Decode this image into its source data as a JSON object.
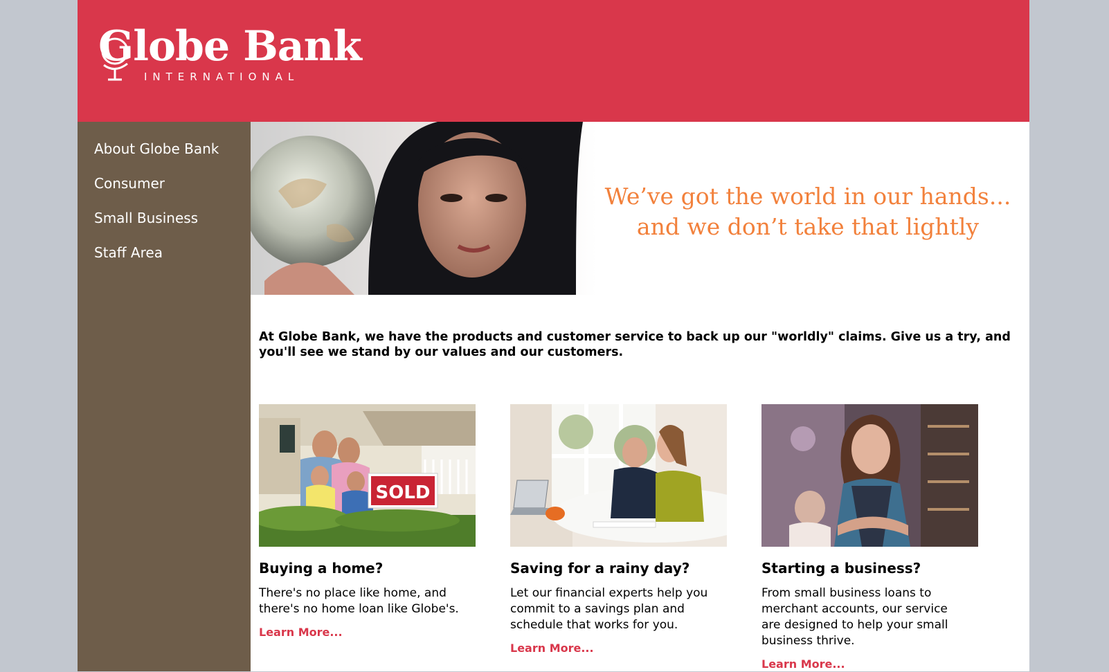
{
  "brand": {
    "name": "Globe Bank",
    "tagline": "INTERNATIONAL",
    "logo_icon": "globe-icon",
    "header_color": "#d9374b",
    "sidebar_color": "#6e5d4a",
    "accent_color": "#f2813c"
  },
  "nav": {
    "items": [
      {
        "label": "About Globe Bank"
      },
      {
        "label": "Consumer"
      },
      {
        "label": "Small Business"
      },
      {
        "label": "Staff Area"
      }
    ]
  },
  "hero": {
    "line1": "We’ve got the world in our hands...",
    "line2": "and we don’t take that lightly"
  },
  "intro": "At Globe Bank, we have the products and customer service to back up our \"worldly\" claims. Give us a try, and you'll see we stand by our values and our customers.",
  "cards": [
    {
      "title": "Buying a home?",
      "text": "There's no place like home, and there's no home loan like Globe's.",
      "link": "Learn More...",
      "image_sign": "SOLD"
    },
    {
      "title": "Saving for a rainy day?",
      "text": "Let our financial experts help you commit to a savings plan and schedule that works for you.",
      "link": "Learn More..."
    },
    {
      "title": "Starting a business?",
      "text": "From small business loans to merchant accounts, our service are designed to help your small business thrive.",
      "link": "Learn More..."
    }
  ]
}
